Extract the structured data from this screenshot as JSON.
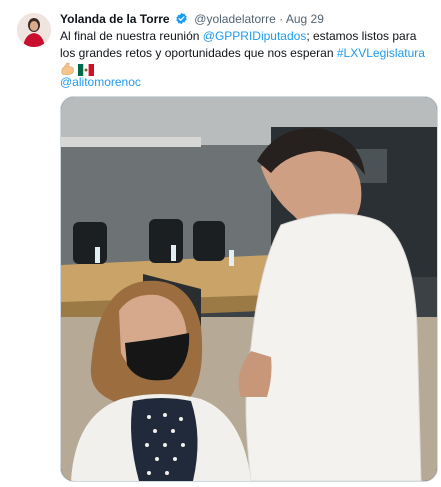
{
  "tweet": {
    "author_name": "Yolanda de la Torre",
    "handle": "@yoladelatorre",
    "separator": "·",
    "date": "Aug 29",
    "text_before": "Al final de nuestra reunión ",
    "mention_group": "@GPPRIDiputados",
    "text_middle": "; estamos listos para los grandes retos y oportunidades que nos esperan ",
    "hashtag": "#LXVLegislatura",
    "mention_line": "@alitomorenoc",
    "emojis": [
      "flexed-biceps-emoji",
      "mexico-flag-emoji"
    ]
  },
  "colors": {
    "link": "#1d9bf0",
    "text": "#0f1419",
    "muted": "#536471",
    "verified": "#1d9bf0"
  },
  "media": {
    "description_icon": "photo-two-people-meeting-room"
  }
}
